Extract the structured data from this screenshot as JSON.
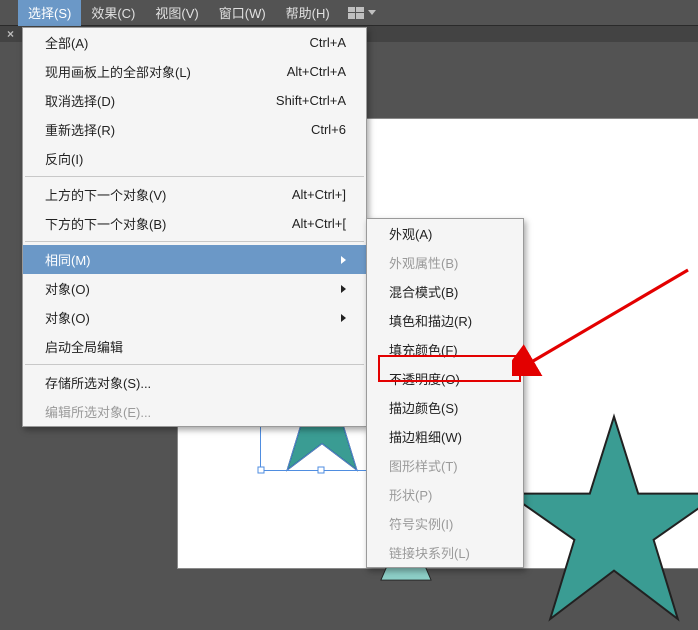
{
  "menubar": {
    "items": [
      {
        "label": "选择(S)"
      },
      {
        "label": "效果(C)"
      },
      {
        "label": "视图(V)"
      },
      {
        "label": "窗口(W)"
      },
      {
        "label": "帮助(H)"
      }
    ]
  },
  "main_menu": {
    "group1": [
      {
        "label": "全部(A)",
        "shortcut": "Ctrl+A"
      },
      {
        "label": "现用画板上的全部对象(L)",
        "shortcut": "Alt+Ctrl+A"
      },
      {
        "label": "取消选择(D)",
        "shortcut": "Shift+Ctrl+A"
      },
      {
        "label": "重新选择(R)",
        "shortcut": "Ctrl+6"
      },
      {
        "label": "反向(I)",
        "shortcut": ""
      }
    ],
    "group2": [
      {
        "label": "上方的下一个对象(V)",
        "shortcut": "Alt+Ctrl+]"
      },
      {
        "label": "下方的下一个对象(B)",
        "shortcut": "Alt+Ctrl+["
      }
    ],
    "group3": [
      {
        "label": "相同(M)",
        "submenu": true,
        "highlight": true
      },
      {
        "label": "对象(O)",
        "submenu": true
      },
      {
        "label": "对象(O)",
        "submenu": true
      },
      {
        "label": "启动全局编辑",
        "submenu": false
      }
    ],
    "group4": [
      {
        "label": "存储所选对象(S)..."
      },
      {
        "label": "编辑所选对象(E)...",
        "disabled": true
      }
    ]
  },
  "sub_menu": {
    "items": [
      {
        "label": "外观(A)"
      },
      {
        "label": "外观属性(B)",
        "disabled": true
      },
      {
        "label": "混合模式(B)"
      },
      {
        "label": "填色和描边(R)"
      },
      {
        "label": "填充颜色(F)"
      },
      {
        "label": "不透明度(O)",
        "annotated": true
      },
      {
        "label": "描边颜色(S)"
      },
      {
        "label": "描边粗细(W)"
      },
      {
        "label": "图形样式(T)",
        "disabled": true
      },
      {
        "label": "形状(P)",
        "disabled": true
      },
      {
        "label": "符号实例(I)",
        "disabled": true
      },
      {
        "label": "链接块系列(L)",
        "disabled": true
      }
    ]
  },
  "colors": {
    "star_fill": "#3a9c93",
    "star_stroke": "#212121",
    "triangle_fill": "#8dcfc7"
  }
}
